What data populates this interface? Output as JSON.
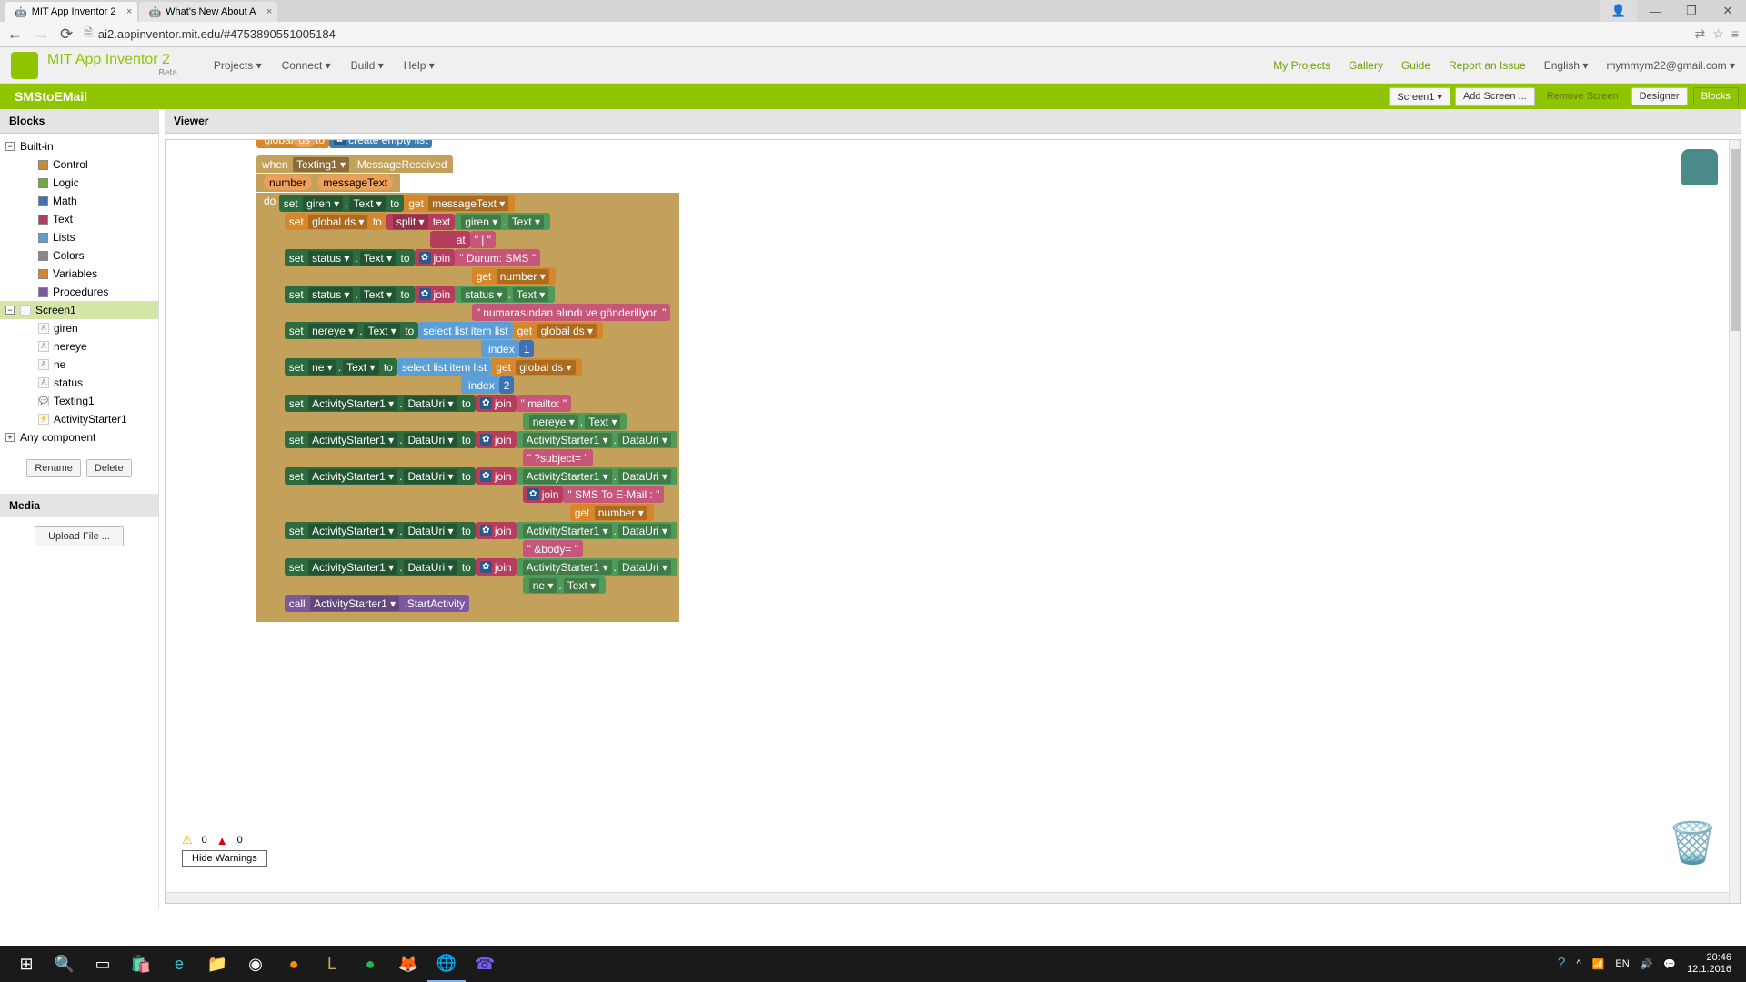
{
  "browser": {
    "tabs": [
      {
        "title": "MIT App Inventor 2",
        "icon": "🤖"
      },
      {
        "title": "What's New About A",
        "icon": "🤖"
      }
    ],
    "url": "ai2.appinventor.mit.edu/#4753890551005184"
  },
  "app": {
    "title": "MIT App Inventor 2",
    "beta": "Beta",
    "menus": [
      "Projects ▾",
      "Connect ▾",
      "Build ▾",
      "Help ▾"
    ],
    "right_links": [
      "My Projects",
      "Gallery",
      "Guide",
      "Report an Issue",
      "English ▾",
      "mymmym22@gmail.com ▾"
    ]
  },
  "project": {
    "name": "SMStoEMail",
    "screen_button": "Screen1 ▾",
    "add_screen": "Add Screen ...",
    "remove_screen": "Remove Screen",
    "designer": "Designer",
    "blocks": "Blocks"
  },
  "left": {
    "header": "Blocks",
    "builtin_label": "Built-in",
    "categories": [
      {
        "name": "Control",
        "color": "#c88a3a"
      },
      {
        "name": "Logic",
        "color": "#77ab41"
      },
      {
        "name": "Math",
        "color": "#3f71b5"
      },
      {
        "name": "Text",
        "color": "#b13e60"
      },
      {
        "name": "Lists",
        "color": "#5c9ed6"
      },
      {
        "name": "Colors",
        "color": "#888"
      },
      {
        "name": "Variables",
        "color": "#d6872b"
      },
      {
        "name": "Procedures",
        "color": "#7c599e"
      }
    ],
    "screen_label": "Screen1",
    "components": [
      "giren",
      "nereye",
      "ne",
      "status",
      "Texting1",
      "ActivityStarter1"
    ],
    "any_component": "Any component",
    "rename": "Rename",
    "delete": "Delete",
    "media": "Media",
    "upload": "Upload File ..."
  },
  "viewer": {
    "header": "Viewer",
    "warnings": "0",
    "errors": "0",
    "hide_warnings": "Hide Warnings"
  },
  "blocks_code": {
    "init_global": "global",
    "init_ds": "ds",
    "init_to": "to",
    "create_empty_list": "create empty list",
    "when": "when",
    "texting1": "Texting1 ▾",
    "msg_received": ".MessageReceived",
    "number": "number",
    "messageText": "messageText",
    "do": "do",
    "set": "set",
    "giren": "giren ▾",
    "text_prop": "Text ▾",
    "to": "to",
    "get": "get",
    "messageText_d": "messageText ▾",
    "global_ds": "global ds ▾",
    "split": "split ▾",
    "text": "text",
    "at": "at",
    "pipe": "\" | \"",
    "status": "status ▾",
    "join": "join",
    "durum_sms": "\" Durum: SMS \"",
    "number_d": "number ▾",
    "status_text": "status ▾ . Text ▾",
    "numarasindan": "\" numarasından alındı ve gönderiliyor. \"",
    "nereye": "nereye ▾",
    "select_list": "select list item  list",
    "index": "index",
    "one": "1",
    "two": "2",
    "ne": "ne ▾",
    "activity_starter": "ActivityStarter1 ▾",
    "datauri": "DataUri ▾",
    "mailto": "\" mailto: \"",
    "nereye_text": "nereye ▾ . Text ▾",
    "subject": "\" ?subject= \"",
    "sms_to_email": "\" SMS To E-Mail : \"",
    "body": "\" &body= \"",
    "ne_text": "ne ▾ . Text ▾",
    "call": "call",
    "start_activity": ".StartActivity"
  },
  "taskbar": {
    "time": "20:46",
    "date": "12.1.2016"
  }
}
